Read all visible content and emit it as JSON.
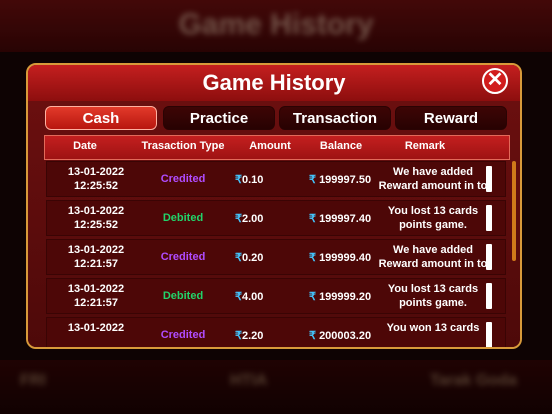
{
  "background": {
    "title": "Game History",
    "bottom_left": "FRI",
    "bottom_mid": "HTIA",
    "bottom_right": "Tarak Goda"
  },
  "dialog": {
    "title": "Game History",
    "close_glyph": "✕"
  },
  "tabs": [
    {
      "label": "Cash",
      "active": true
    },
    {
      "label": "Practice",
      "active": false
    },
    {
      "label": "Transaction",
      "active": false
    },
    {
      "label": "Reward",
      "active": false
    }
  ],
  "table": {
    "headers": {
      "date": "Date",
      "type": "Trasaction Type",
      "amount": "Amount",
      "balance": "Balance",
      "remark": "Remark"
    },
    "currency": "₹",
    "rows": [
      {
        "date": "13-01-2022",
        "time": "12:25:52",
        "type": "Credited",
        "amount": "0.10",
        "balance": "199997.50",
        "remark1": "We have added",
        "remark2": "Reward amount in to"
      },
      {
        "date": "13-01-2022",
        "time": "12:25:52",
        "type": "Debited",
        "amount": "2.00",
        "balance": "199997.40",
        "remark1": "You lost 13 cards",
        "remark2": "points game."
      },
      {
        "date": "13-01-2022",
        "time": "12:21:57",
        "type": "Credited",
        "amount": "0.20",
        "balance": "199999.40",
        "remark1": "We have added",
        "remark2": "Reward amount in to"
      },
      {
        "date": "13-01-2022",
        "time": "12:21:57",
        "type": "Debited",
        "amount": "4.00",
        "balance": "199999.20",
        "remark1": "You lost 13 cards",
        "remark2": "points game."
      },
      {
        "date": "13-01-2022",
        "time": "",
        "type": "Credited",
        "amount": "2.20",
        "balance": "200003.20",
        "remark1": "You won 13 cards",
        "remark2": ""
      }
    ]
  },
  "colors": {
    "credited": "#b04cff",
    "debited": "#22d36a",
    "rupee": "#43c6ff",
    "accent": "#d89a3a"
  }
}
